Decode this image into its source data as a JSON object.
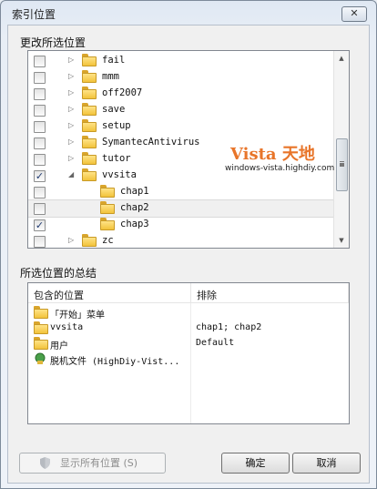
{
  "window": {
    "title": "索引位置",
    "close_glyph": "✕"
  },
  "tree_section": {
    "label": "更改所选位置"
  },
  "tree": {
    "items": [
      {
        "label": "fail",
        "checked": false,
        "expanded": false,
        "level": 1
      },
      {
        "label": "mmm",
        "checked": false,
        "expanded": false,
        "level": 1
      },
      {
        "label": "off2007",
        "checked": false,
        "expanded": false,
        "level": 1
      },
      {
        "label": "save",
        "checked": false,
        "expanded": false,
        "level": 1
      },
      {
        "label": "setup",
        "checked": false,
        "expanded": false,
        "level": 1
      },
      {
        "label": "SymantecAntivirus",
        "checked": false,
        "expanded": false,
        "level": 1
      },
      {
        "label": "tutor",
        "checked": false,
        "expanded": false,
        "level": 1
      },
      {
        "label": "vvsita",
        "checked": true,
        "expanded": true,
        "level": 1
      },
      {
        "label": "chap1",
        "checked": false,
        "level": 2
      },
      {
        "label": "chap2",
        "checked": false,
        "level": 2,
        "selected": true
      },
      {
        "label": "chap3",
        "checked": true,
        "level": 2
      },
      {
        "label": "zc",
        "checked": false,
        "expanded": false,
        "level": 1
      }
    ],
    "check_glyph": "✓",
    "collapsed_glyph": "▷",
    "expanded_glyph": "◢"
  },
  "watermark": {
    "title": "Vista 天地",
    "url": "windows-vista.highdiy.com"
  },
  "summary_section": {
    "label": "所选位置的总结"
  },
  "summary": {
    "columns": [
      "包含的位置",
      "排除"
    ],
    "rows": [
      {
        "location": "「开始」菜单",
        "exclude": "",
        "icon": "folder-icon"
      },
      {
        "location": "vvsita",
        "exclude": "chap1; chap2",
        "icon": "folder-icon"
      },
      {
        "location": "用户",
        "exclude": "Default",
        "icon": "folder-icon"
      },
      {
        "location": "脱机文件 (HighDiy-Vist...",
        "exclude": "",
        "icon": "offline-files-icon"
      }
    ]
  },
  "buttons": {
    "show_all": "显示所有位置 (S)",
    "ok": "确定",
    "cancel": "取消"
  },
  "colors": {
    "accent": "#e8752a",
    "folder": "#f2c33b"
  }
}
